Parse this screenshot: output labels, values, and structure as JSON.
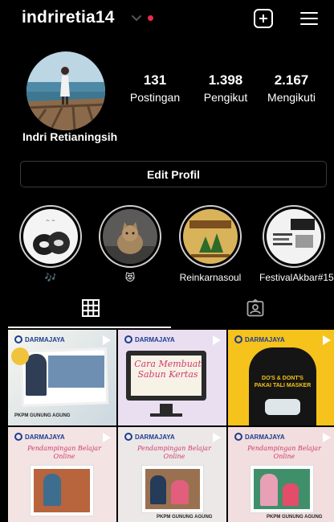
{
  "header": {
    "username": "indriretia14",
    "icons": [
      "chevron-down-icon",
      "notification-dot",
      "new-post-icon",
      "menu-icon"
    ],
    "accent": "#ed2b4a"
  },
  "profile": {
    "full_name": "Indri Retianingsih",
    "stats": [
      {
        "value": "131",
        "label": "Postingan"
      },
      {
        "value": "1.398",
        "label": "Pengikut"
      },
      {
        "value": "2.167",
        "label": "Mengikuti"
      }
    ],
    "edit_button": "Edit Profil"
  },
  "highlights": [
    {
      "caption": "🎶"
    },
    {
      "caption": "😻"
    },
    {
      "caption": "Reinkarnasoul"
    },
    {
      "caption": "FestivalAkbar#15"
    }
  ],
  "tabs": {
    "grid_icon": "grid-icon",
    "tagged_icon": "tagged-icon"
  },
  "posts": [
    {
      "brand": "DARMAJAYA",
      "footer": "PKPM GUNUNG AGUNG"
    },
    {
      "brand": "DARMAJAYA",
      "title": "Cara Membuat Sabun Kertas"
    },
    {
      "brand": "DARMAJAYA",
      "title": "DO'S & DONT'S PAKAI TALI MASKER"
    },
    {
      "brand": "DARMAJAYA",
      "title": "Pendampingan Belajar Online"
    },
    {
      "brand": "DARMAJAYA",
      "title": "Pendampingan Belajar Online",
      "footer": "PKPM GUNUNG AGUNG"
    },
    {
      "brand": "DARMAJAYA",
      "title": "Pendampingan Belajar Online",
      "footer": "PKPM GUNUNG AGUNG"
    }
  ]
}
